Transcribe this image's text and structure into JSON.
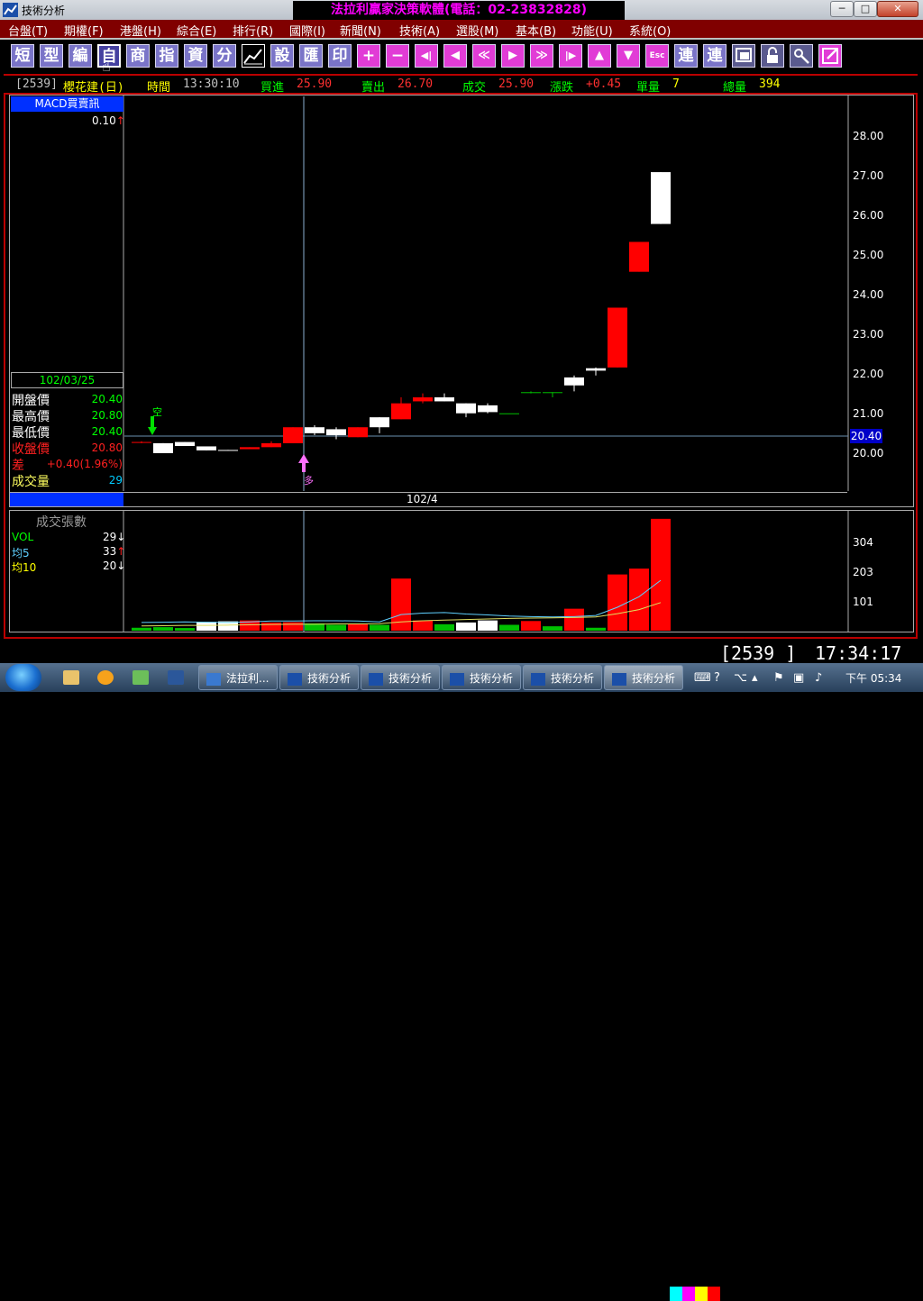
{
  "window": {
    "title": "技術分析",
    "banner": "法拉利贏家決策軟體(電話：02-23832828)",
    "min": "─",
    "max": "□",
    "close": "✕"
  },
  "menu": [
    "台盤(T)",
    "期權(F)",
    "港盤(H)",
    "綜合(E)",
    "排行(R)",
    "國際(I)",
    "新聞(N)",
    "技術(A)",
    "選股(M)",
    "基本(B)",
    "功能(U)",
    "系統(O)"
  ],
  "toolbar": [
    "短",
    "型",
    "編",
    "自",
    "商",
    "指",
    "資",
    "分",
    "",
    "設",
    "匯",
    "印",
    "+",
    "−",
    "◀|",
    "◀",
    "≪",
    "▶",
    "≫",
    "|▶",
    "▲",
    "▼",
    "Esc",
    "連",
    "連",
    "",
    "",
    ""
  ],
  "info": {
    "code": "[2539]",
    "name": "櫻花建(日)",
    "time_label": "時間",
    "time": "13:30:10",
    "bid_label": "買進",
    "bid": "25.90",
    "ask_label": "賣出",
    "ask": "26.70",
    "deal_label": "成交",
    "deal": "25.90",
    "chg_label": "漲跌",
    "chg": "+0.45",
    "unit_label": "單量",
    "unit": "7",
    "total_label": "總量",
    "total": "394"
  },
  "macd": {
    "title": "MACD買賣訊",
    "value": "0.10",
    "arrow": "↑"
  },
  "ohlc": {
    "date": "102/03/25",
    "rows": [
      {
        "label": "開盤價",
        "value": "20.40"
      },
      {
        "label": "最高價",
        "value": "20.80"
      },
      {
        "label": "最低價",
        "value": "20.40"
      },
      {
        "label": "收盤價",
        "value": "20.80"
      },
      {
        "label": "差",
        "value": "+0.40(1.96%)"
      },
      {
        "label": "成交量",
        "value": "29"
      }
    ]
  },
  "signals": {
    "short": "空",
    "long": "多"
  },
  "date_tick": "102/4",
  "price_axis": [
    "28.00",
    "27.00",
    "26.00",
    "25.00",
    "24.00",
    "23.00",
    "22.00",
    "21.00",
    "20.00"
  ],
  "current_price": "20.40",
  "volume_panel": {
    "title": "成交張數",
    "rows": [
      {
        "label": "VOL",
        "value": "29",
        "arrow": "↓"
      },
      {
        "label": "均5",
        "value": "33",
        "arrow": "↑"
      },
      {
        "label": "均10",
        "value": "20",
        "arrow": "↓"
      }
    ],
    "axis": [
      "304",
      "203",
      "101"
    ]
  },
  "status": {
    "code": "2539_",
    "time": "17:34:17"
  },
  "taskbar": {
    "tasks": [
      "法拉利...",
      "技術分析",
      "技術分析",
      "技術分析",
      "技術分析",
      "技術分析"
    ],
    "clock": "下午 05:34"
  },
  "colors": {
    "up": "#ff0000",
    "down": "#ffffff",
    "flat": "#00c000",
    "menu_bg": "#800000",
    "banner": "#ff00ff"
  },
  "chart_data": {
    "type": "candlestick",
    "y_range": [
      19.2,
      29.1
    ],
    "candles": [
      {
        "o": 20.42,
        "c": 20.43,
        "h": 20.45,
        "l": 20.4
      },
      {
        "o": 20.4,
        "c": 20.15,
        "h": 20.4,
        "l": 20.15
      },
      {
        "o": 20.43,
        "c": 20.33,
        "h": 20.43,
        "l": 20.33
      },
      {
        "o": 20.32,
        "c": 20.22,
        "h": 20.32,
        "l": 20.22
      },
      {
        "o": 20.23,
        "c": 20.22,
        "h": 20.23,
        "l": 20.22
      },
      {
        "o": 20.25,
        "c": 20.3,
        "h": 20.3,
        "l": 20.25
      },
      {
        "o": 20.3,
        "c": 20.4,
        "h": 20.45,
        "l": 20.3
      },
      {
        "o": 20.4,
        "c": 20.8,
        "h": 20.8,
        "l": 20.4
      },
      {
        "o": 20.8,
        "c": 20.65,
        "h": 20.85,
        "l": 20.6
      },
      {
        "o": 20.75,
        "c": 20.6,
        "h": 20.8,
        "l": 20.5
      },
      {
        "o": 20.55,
        "c": 20.8,
        "h": 20.8,
        "l": 20.55
      },
      {
        "o": 21.05,
        "c": 20.8,
        "h": 21.05,
        "l": 20.65
      },
      {
        "o": 21.0,
        "c": 21.4,
        "h": 21.55,
        "l": 21.0
      },
      {
        "o": 21.45,
        "c": 21.55,
        "h": 21.65,
        "l": 21.4
      },
      {
        "o": 21.55,
        "c": 21.45,
        "h": 21.65,
        "l": 21.45
      },
      {
        "o": 21.4,
        "c": 21.15,
        "h": 21.4,
        "l": 21.05
      },
      {
        "o": 21.35,
        "c": 21.18,
        "h": 21.4,
        "l": 21.15
      },
      {
        "o": 21.15,
        "c": 21.15,
        "h": 21.15,
        "l": 21.15
      },
      {
        "o": 21.68,
        "c": 21.68,
        "h": 21.7,
        "l": 21.65
      },
      {
        "o": 21.68,
        "c": 21.68,
        "h": 21.68,
        "l": 21.55
      },
      {
        "o": 22.05,
        "c": 21.85,
        "h": 22.1,
        "l": 21.7
      },
      {
        "o": 22.28,
        "c": 22.22,
        "h": 22.3,
        "l": 22.1
      },
      {
        "o": 22.3,
        "c": 23.8,
        "h": 23.8,
        "l": 22.3
      },
      {
        "o": 24.7,
        "c": 25.45,
        "h": 25.45,
        "l": 24.7
      },
      {
        "o": 27.2,
        "c": 25.9,
        "h": 27.2,
        "l": 25.9
      }
    ],
    "volume": [
      {
        "v": 10,
        "up": false
      },
      {
        "v": 12,
        "up": false
      },
      {
        "v": 9,
        "up": false
      },
      {
        "v": 30,
        "up": false
      },
      {
        "v": 32,
        "up": false
      },
      {
        "v": 35,
        "up": true
      },
      {
        "v": 28,
        "up": true
      },
      {
        "v": 29,
        "up": true
      },
      {
        "v": 25,
        "up": false
      },
      {
        "v": 20,
        "up": false
      },
      {
        "v": 22,
        "up": true
      },
      {
        "v": 20,
        "up": false
      },
      {
        "v": 178,
        "up": true
      },
      {
        "v": 35,
        "up": true
      },
      {
        "v": 22,
        "up": false
      },
      {
        "v": 28,
        "up": false
      },
      {
        "v": 35,
        "up": false
      },
      {
        "v": 20,
        "up": false
      },
      {
        "v": 33,
        "up": true
      },
      {
        "v": 15,
        "up": false
      },
      {
        "v": 75,
        "up": true
      },
      {
        "v": 10,
        "up": false
      },
      {
        "v": 192,
        "up": true
      },
      {
        "v": 212,
        "up": true
      },
      {
        "v": 382,
        "up": true
      }
    ],
    "vol_range": [
      0,
      400
    ],
    "ma5": [
      28,
      29,
      30,
      29,
      28,
      30,
      33,
      33,
      34,
      34,
      33,
      30,
      55,
      60,
      62,
      57,
      54,
      50,
      48,
      47,
      48,
      52,
      80,
      116,
      172
    ],
    "ma10": [
      16,
      17,
      18,
      18,
      19,
      20,
      21,
      22,
      22,
      23,
      23,
      24,
      30,
      34,
      36,
      38,
      40,
      42,
      43,
      44,
      45,
      47,
      58,
      72,
      96
    ]
  }
}
